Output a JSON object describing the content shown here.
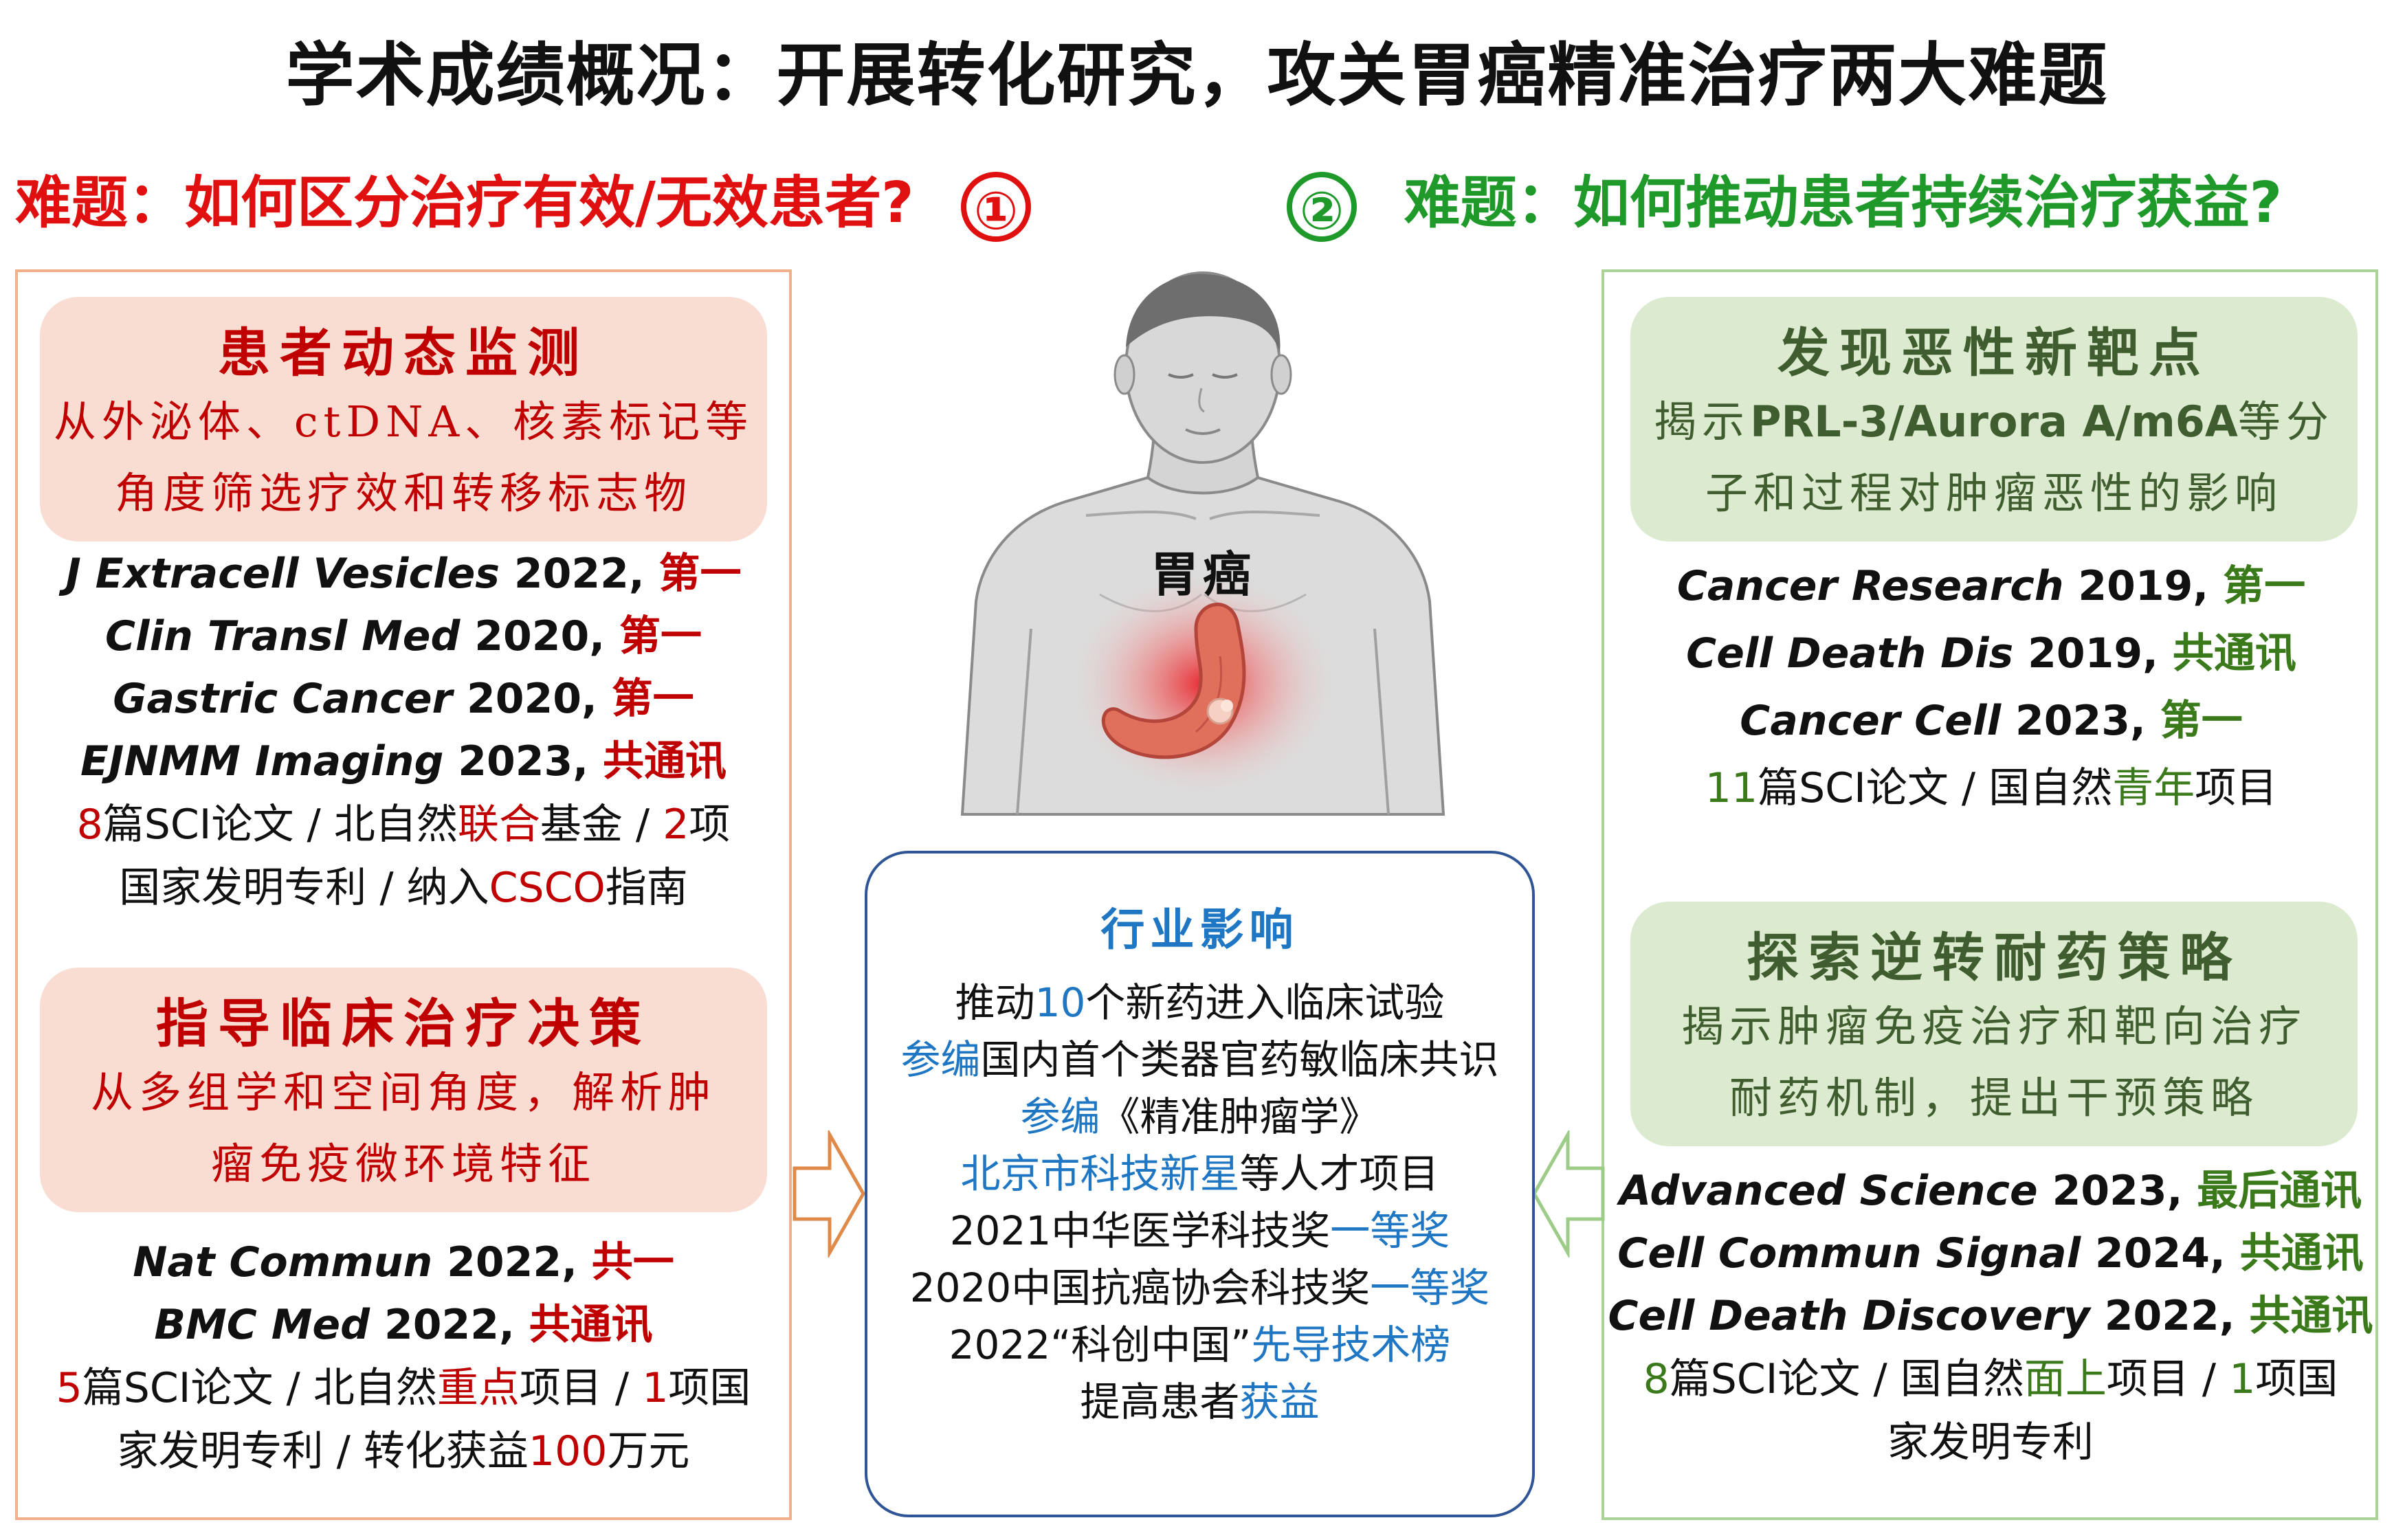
{
  "title": "学术成绩概况：开展转化研究，攻关胃癌精准治疗两大难题",
  "question_left": {
    "text": "难题：如何区分治疗有效/无效患者?",
    "number": "①"
  },
  "question_right": {
    "text": "难题：如何推动患者持续治疗获益?",
    "number": "②"
  },
  "center_label": "胃癌",
  "left_panel": {
    "box1": {
      "heading": "患者动态监测",
      "line1": "从外泌体、ctDNA、核素标记等",
      "line2": "角度筛选疗效和转移标志物"
    },
    "refs1": [
      {
        "journal": "J Extracell Vesicles",
        "year": " 2022, ",
        "role": "第一"
      },
      {
        "journal": "Clin Transl Med",
        "year": " 2020, ",
        "role": "第一"
      },
      {
        "journal": "Gastric Cancer",
        "year": " 2020, ",
        "role": "第一"
      },
      {
        "journal": "EJNMM Imaging",
        "year": " 2023, ",
        "role": "共通讯"
      }
    ],
    "summary1": {
      "a": "8",
      "b": "篇SCI论文 / 北自然",
      "c": "联合",
      "d": "基金 / ",
      "e": "2",
      "f": "项",
      "g": "国家发明专利 / 纳入",
      "h": "CSCO",
      "i": "指南"
    },
    "box2": {
      "heading": "指导临床治疗决策",
      "line1": "从多组学和空间角度，解析肿",
      "line2": "瘤免疫微环境特征"
    },
    "refs2": [
      {
        "journal": "Nat Commun",
        "year": " 2022, ",
        "role": "共一"
      },
      {
        "journal": "BMC Med",
        "year": " 2022, ",
        "role": "共通讯"
      }
    ],
    "summary2": {
      "a": "5",
      "b": "篇SCI论文 / 北自然",
      "c": "重点",
      "d": "项目 / ",
      "e": "1",
      "f": "项国",
      "g": "家发明专利 / 转化获益",
      "h": "100",
      "i": "万元"
    }
  },
  "right_panel": {
    "box1": {
      "heading": "发现恶性新靶点",
      "line1a": "揭示",
      "line1b": "PRL-3/Aurora A/m6A",
      "line1c": "等分",
      "line2": "子和过程对肿瘤恶性的影响"
    },
    "refs1": [
      {
        "journal": "Cancer Research",
        "year": " 2019, ",
        "role": "第一"
      },
      {
        "journal": "Cell Death Dis",
        "year": " 2019, ",
        "role": "共通讯"
      },
      {
        "journal": "Cancer Cell",
        "year": " 2023, ",
        "role": "第一"
      }
    ],
    "summary1": {
      "a": "11",
      "b": "篇SCI论文 / 国自然",
      "c": "青年",
      "d": "项目"
    },
    "box2": {
      "heading": "探索逆转耐药策略",
      "line1": "揭示肿瘤免疫治疗和靶向治疗",
      "line2": "耐药机制，提出干预策略"
    },
    "refs2": [
      {
        "journal": "Advanced Science",
        "year": " 2023, ",
        "role": "最后通讯"
      },
      {
        "journal": "Cell Commun Signal",
        "year": " 2024, ",
        "role": "共通讯"
      },
      {
        "journal": "Cell Death Discovery",
        "year": " 2022, ",
        "role": "共通讯"
      }
    ],
    "summary2": {
      "a": "8",
      "b": "篇SCI论文 / 国自然",
      "c": "面上",
      "d": "项目 / ",
      "e": "1",
      "f": "项国",
      "g": "家发明专利"
    }
  },
  "impact": {
    "heading": "行业影响",
    "l1a": "推动",
    "l1b": "10",
    "l1c": "个新药进入临床试验",
    "l2a": "参编",
    "l2b": "国内首个类器官药敏临床共识",
    "l3a": "参编",
    "l3b": "《精准肿瘤学》",
    "l4a": "北京市科技新星",
    "l4b": "等人才项目",
    "l5a": "2021中华医学科技奖",
    "l5b": "一等奖",
    "l6a": "2020中国抗癌协会科技奖",
    "l6b": "一等奖",
    "l7a": "2022“科创中国”",
    "l7b": "先导技术榜",
    "l8a": "提高患者",
    "l8b": "获益"
  },
  "colors": {
    "red": "#c00000",
    "question_red": "#e01010",
    "question_green": "#1f9a2a",
    "dark_green": "#3a7a1a",
    "blue": "#1f77c4",
    "impact_border": "#2f5597"
  }
}
